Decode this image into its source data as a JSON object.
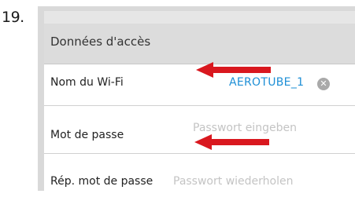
{
  "step": {
    "number": "19."
  },
  "section": {
    "title": "Données d'accès"
  },
  "fields": {
    "ssid": {
      "label": "Nom du Wi-Fi",
      "value": "AEROTUBE_1",
      "clear_icon": "clear-circle-x"
    },
    "password": {
      "label": "Mot de passe",
      "placeholder": "Passwort eingeben"
    },
    "password_repeat": {
      "label": "Rép. mot de passe",
      "placeholder": "Passwort wiederholen"
    }
  },
  "colors": {
    "accent_value": "#1e8fd6",
    "arrow": "#d9181f",
    "header_bg": "#dcdcdc"
  },
  "icons": {
    "annotation_arrow": "red-left-arrow"
  }
}
